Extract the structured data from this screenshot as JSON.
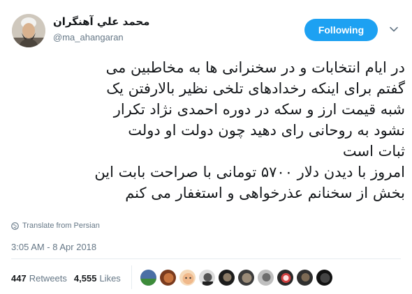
{
  "author": {
    "name": "محمد علي آهنگران",
    "handle": "@ma_ahangaran"
  },
  "follow_button": {
    "label": "Following"
  },
  "tweet": {
    "lines": [
      "در ایام انتخابات و در سخنرانی ها به مخاطبین می",
      "گفتم برای اینکه رخدادهای تلخی نظیر بالارفتن یک",
      "شبه قیمت ارز و سکه در دوره احمدی نژاد تکرار",
      "نشود به روحانی رای دهید چون دولت او دولت",
      "ثبات است",
      "امروز با دیدن دلار ۵۷۰۰ تومانی با صراحت بابت این",
      "بخش از سخنانم عذرخواهی و استغفار می کنم"
    ]
  },
  "translate": {
    "label": "Translate from Persian"
  },
  "timestamp": "3:05 AM - 8 Apr 2018",
  "stats": {
    "retweets_count": "447",
    "retweets_label": "Retweets",
    "likes_count": "4,555",
    "likes_label": "Likes"
  },
  "colors": {
    "accent": "#1da1f2",
    "secondary_text": "#657786",
    "primary_text": "#14171a",
    "divider": "#e6ecf0"
  },
  "icons": {
    "menu": "chevron-down-icon",
    "translate": "globe-icon"
  }
}
